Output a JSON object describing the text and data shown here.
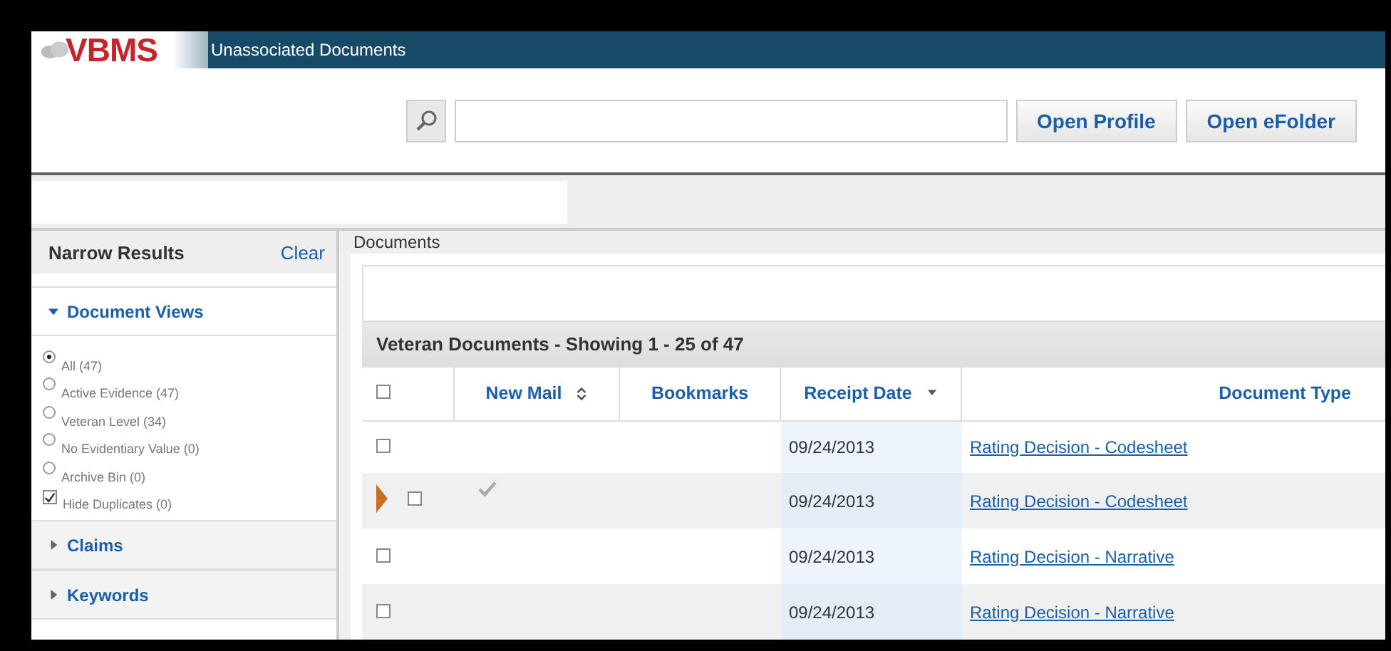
{
  "header": {
    "logo": "VBMS",
    "title": "Unassociated Documents"
  },
  "toolbar": {
    "buttons": [
      "Open Profile",
      "Open eFolder"
    ]
  },
  "sidebar": {
    "title": "Narrow Results",
    "clear": "Clear",
    "sections": [
      {
        "label": "Document Views",
        "expanded": true,
        "options": [
          {
            "kind": "radio",
            "label": "All (47)",
            "selected": true
          },
          {
            "kind": "radio",
            "label": "Active Evidence (47)",
            "selected": false
          },
          {
            "kind": "radio",
            "label": "Veteran Level (34)",
            "selected": false
          },
          {
            "kind": "radio",
            "label": "No Evidentiary Value (0)",
            "selected": false
          },
          {
            "kind": "radio",
            "label": "Archive Bin (0)",
            "selected": false
          },
          {
            "kind": "checkbox",
            "label": "Hide Duplicates (0)",
            "checked": true
          }
        ]
      },
      {
        "label": "Claims",
        "expanded": false
      },
      {
        "label": "Keywords",
        "expanded": false
      }
    ]
  },
  "main": {
    "title": "Documents",
    "table": {
      "title": "Veteran Documents - Showing 1 - 25 of 47",
      "all_checked": false,
      "columns": [
        {
          "label": "New Mail",
          "kind": "sortable"
        },
        {
          "label": "Bookmarks",
          "kind": "plain"
        },
        {
          "label": "Receipt Date",
          "kind": "sorted"
        },
        {
          "label": "Document Type",
          "kind": "plain"
        }
      ],
      "rows": [
        {
          "selected": false,
          "checked": false,
          "new_mail": false,
          "date": "09/24/2013",
          "type": "Rating Decision - Codesheet"
        },
        {
          "selected": true,
          "checked": false,
          "new_mail": true,
          "date": "09/24/2013",
          "type": "Rating Decision - Codesheet"
        },
        {
          "selected": false,
          "checked": false,
          "new_mail": false,
          "date": "09/24/2013",
          "type": "Rating Decision - Narrative"
        },
        {
          "selected": false,
          "checked": false,
          "new_mail": false,
          "date": "09/24/2013",
          "type": "Rating Decision - Narrative"
        }
      ]
    }
  }
}
